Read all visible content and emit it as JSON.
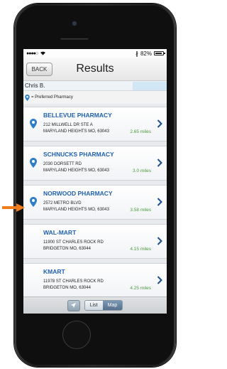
{
  "status": {
    "battery_pct": "82%"
  },
  "header": {
    "back_label": "BACK",
    "title": "Results"
  },
  "user": {
    "name": "Chris B."
  },
  "legend": {
    "label": "= Preferred Pharmacy"
  },
  "pharmacies": [
    {
      "name": "BELLEVUE PHARMACY",
      "address1": "212 MILLWELL DR STE A",
      "address2": "MARYLAND HEIGHTS MO, 63043",
      "distance": "2.65 miles",
      "preferred": true
    },
    {
      "name": "SCHNUCKS PHARMACY",
      "address1": "2030 DORSETT RD",
      "address2": "MARYLAND HEIGHTS MO, 63043",
      "distance": "3.0 miles",
      "preferred": true
    },
    {
      "name": "NORWOOD PHARMACY",
      "address1": "2572 METRO BLVD",
      "address2": "MARYLAND HEIGHTS MO, 63043",
      "distance": "3.58 miles",
      "preferred": true
    },
    {
      "name": "WAL-MART",
      "address1": "11900 ST CHARLES ROCK RD",
      "address2": "BRIDGETON MO, 63044",
      "distance": "4.15 miles",
      "preferred": false
    },
    {
      "name": "KMART",
      "address1": "11978 ST CHARLES ROCK RD",
      "address2": "BRIDGETON MO, 63044",
      "distance": "4.25 miles",
      "preferred": false
    }
  ],
  "tabbar": {
    "list_label": "List",
    "map_label": "Map"
  },
  "colors": {
    "name_blue": "#1f60b0",
    "distance_green": "#4a9a3c",
    "pin_blue": "#2f7fc8",
    "arrow_orange": "#f07c1c"
  }
}
